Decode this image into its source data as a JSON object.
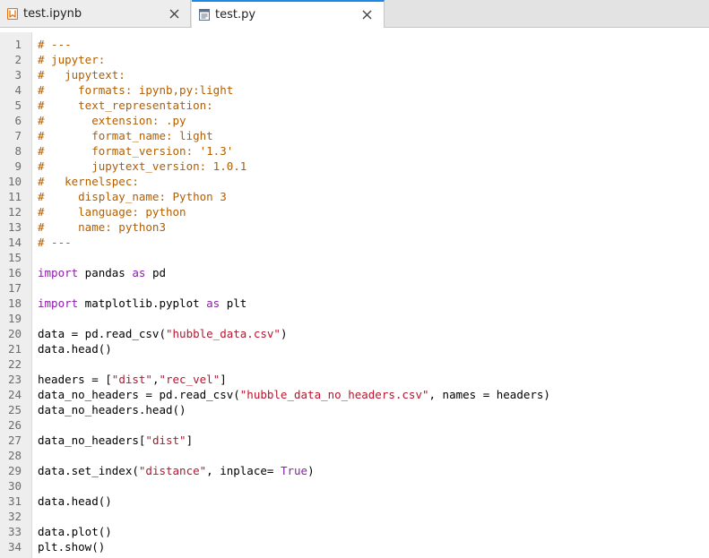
{
  "tabs": [
    {
      "label": "test.ipynb",
      "icon": "notebook-icon",
      "active": false
    },
    {
      "label": "test.py",
      "icon": "file-text-icon",
      "active": true
    }
  ],
  "colors": {
    "comment": "#b25e00",
    "keyword": "#8a1ea8",
    "string": "#b5162e",
    "active_tab_accent": "#1e88e5"
  },
  "editor": {
    "lines": [
      {
        "n": "1",
        "tokens": [
          {
            "t": "# ---",
            "c": "cm"
          }
        ]
      },
      {
        "n": "2",
        "tokens": [
          {
            "t": "# jupyter:",
            "c": "cm"
          }
        ]
      },
      {
        "n": "3",
        "tokens": [
          {
            "t": "#   jupytext:",
            "c": "cm"
          }
        ]
      },
      {
        "n": "4",
        "tokens": [
          {
            "t": "#     formats: ipynb,py:light",
            "c": "cm"
          }
        ]
      },
      {
        "n": "5",
        "tokens": [
          {
            "t": "#     text_representation:",
            "c": "cm"
          }
        ]
      },
      {
        "n": "6",
        "tokens": [
          {
            "t": "#       extension: .py",
            "c": "cm"
          }
        ]
      },
      {
        "n": "7",
        "tokens": [
          {
            "t": "#       format_name: light",
            "c": "cm"
          }
        ]
      },
      {
        "n": "8",
        "tokens": [
          {
            "t": "#       format_version: '1.3'",
            "c": "cm"
          }
        ]
      },
      {
        "n": "9",
        "tokens": [
          {
            "t": "#       jupytext_version: 1.0.1",
            "c": "cm"
          }
        ]
      },
      {
        "n": "10",
        "tokens": [
          {
            "t": "#   kernelspec:",
            "c": "cm"
          }
        ]
      },
      {
        "n": "11",
        "tokens": [
          {
            "t": "#     display_name: Python 3",
            "c": "cm"
          }
        ]
      },
      {
        "n": "12",
        "tokens": [
          {
            "t": "#     language: python",
            "c": "cm"
          }
        ]
      },
      {
        "n": "13",
        "tokens": [
          {
            "t": "#     name: python3",
            "c": "cm"
          }
        ]
      },
      {
        "n": "14",
        "tokens": [
          {
            "t": "# ---",
            "c": "cm"
          }
        ]
      },
      {
        "n": "15",
        "tokens": []
      },
      {
        "n": "16",
        "tokens": [
          {
            "t": "import",
            "c": "kw"
          },
          {
            "t": " pandas "
          },
          {
            "t": "as",
            "c": "kw"
          },
          {
            "t": " pd"
          }
        ]
      },
      {
        "n": "17",
        "tokens": []
      },
      {
        "n": "18",
        "tokens": [
          {
            "t": "import",
            "c": "kw"
          },
          {
            "t": " matplotlib.pyplot "
          },
          {
            "t": "as",
            "c": "kw"
          },
          {
            "t": " plt"
          }
        ]
      },
      {
        "n": "19",
        "tokens": []
      },
      {
        "n": "20",
        "tokens": [
          {
            "t": "data = pd.read_csv("
          },
          {
            "t": "\"hubble_data.csv\"",
            "c": "str"
          },
          {
            "t": ")"
          }
        ]
      },
      {
        "n": "21",
        "tokens": [
          {
            "t": "data.head()"
          }
        ]
      },
      {
        "n": "22",
        "tokens": []
      },
      {
        "n": "23",
        "tokens": [
          {
            "t": "headers = ["
          },
          {
            "t": "\"dist\"",
            "c": "str"
          },
          {
            "t": ","
          },
          {
            "t": "\"rec_vel\"",
            "c": "str"
          },
          {
            "t": "]"
          }
        ]
      },
      {
        "n": "24",
        "tokens": [
          {
            "t": "data_no_headers = pd.read_csv("
          },
          {
            "t": "\"hubble_data_no_headers.csv\"",
            "c": "str"
          },
          {
            "t": ", names = headers)"
          }
        ]
      },
      {
        "n": "25",
        "tokens": [
          {
            "t": "data_no_headers.head()"
          }
        ]
      },
      {
        "n": "26",
        "tokens": []
      },
      {
        "n": "27",
        "tokens": [
          {
            "t": "data_no_headers["
          },
          {
            "t": "\"dist\"",
            "c": "str"
          },
          {
            "t": "]"
          }
        ]
      },
      {
        "n": "28",
        "tokens": []
      },
      {
        "n": "29",
        "tokens": [
          {
            "t": "data.set_index("
          },
          {
            "t": "\"distance\"",
            "c": "str"
          },
          {
            "t": ", inplace= "
          },
          {
            "t": "True",
            "c": "kw"
          },
          {
            "t": ")"
          }
        ]
      },
      {
        "n": "30",
        "tokens": []
      },
      {
        "n": "31",
        "tokens": [
          {
            "t": "data.head()"
          }
        ]
      },
      {
        "n": "32",
        "tokens": []
      },
      {
        "n": "33",
        "tokens": [
          {
            "t": "data.plot()"
          }
        ]
      },
      {
        "n": "34",
        "tokens": [
          {
            "t": "plt.show()"
          }
        ]
      }
    ]
  }
}
